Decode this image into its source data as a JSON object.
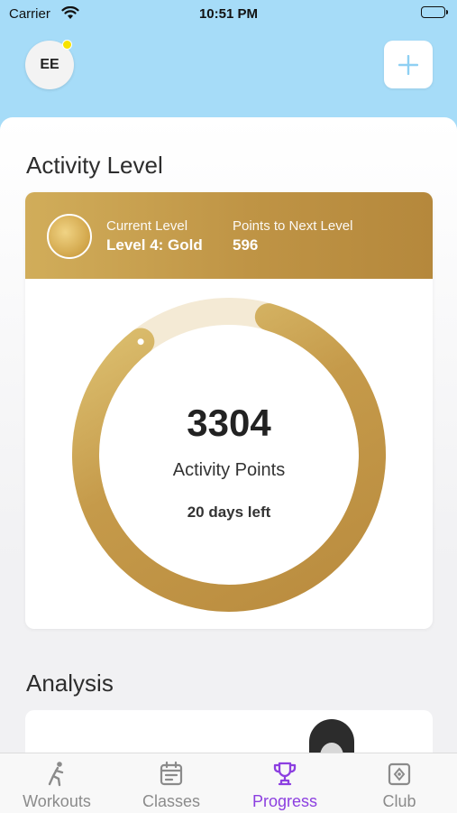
{
  "status_bar": {
    "carrier": "Carrier",
    "time": "10:51 PM"
  },
  "header": {
    "avatar_initials": "EE"
  },
  "activity": {
    "section_title": "Activity Level",
    "current_level_label": "Current Level",
    "current_level_value": "Level 4: Gold",
    "points_next_label": "Points to Next Level",
    "points_next_value": "596",
    "points": "3304",
    "points_label": "Activity Points",
    "days_left": "20 days left",
    "progress_fraction": 0.85
  },
  "analysis": {
    "section_title": "Analysis"
  },
  "tabs": [
    {
      "label": "Workouts",
      "icon": "runner-icon"
    },
    {
      "label": "Classes",
      "icon": "calendar-icon"
    },
    {
      "label": "Progress",
      "icon": "trophy-icon",
      "active": true
    },
    {
      "label": "Club",
      "icon": "club-icon"
    }
  ],
  "colors": {
    "sky": "#a6dcf8",
    "gold": "#c59a4a",
    "gold_light": "#f4ead5",
    "active_tab": "#8c3fe0",
    "inactive_tab": "#8b8b8b"
  }
}
